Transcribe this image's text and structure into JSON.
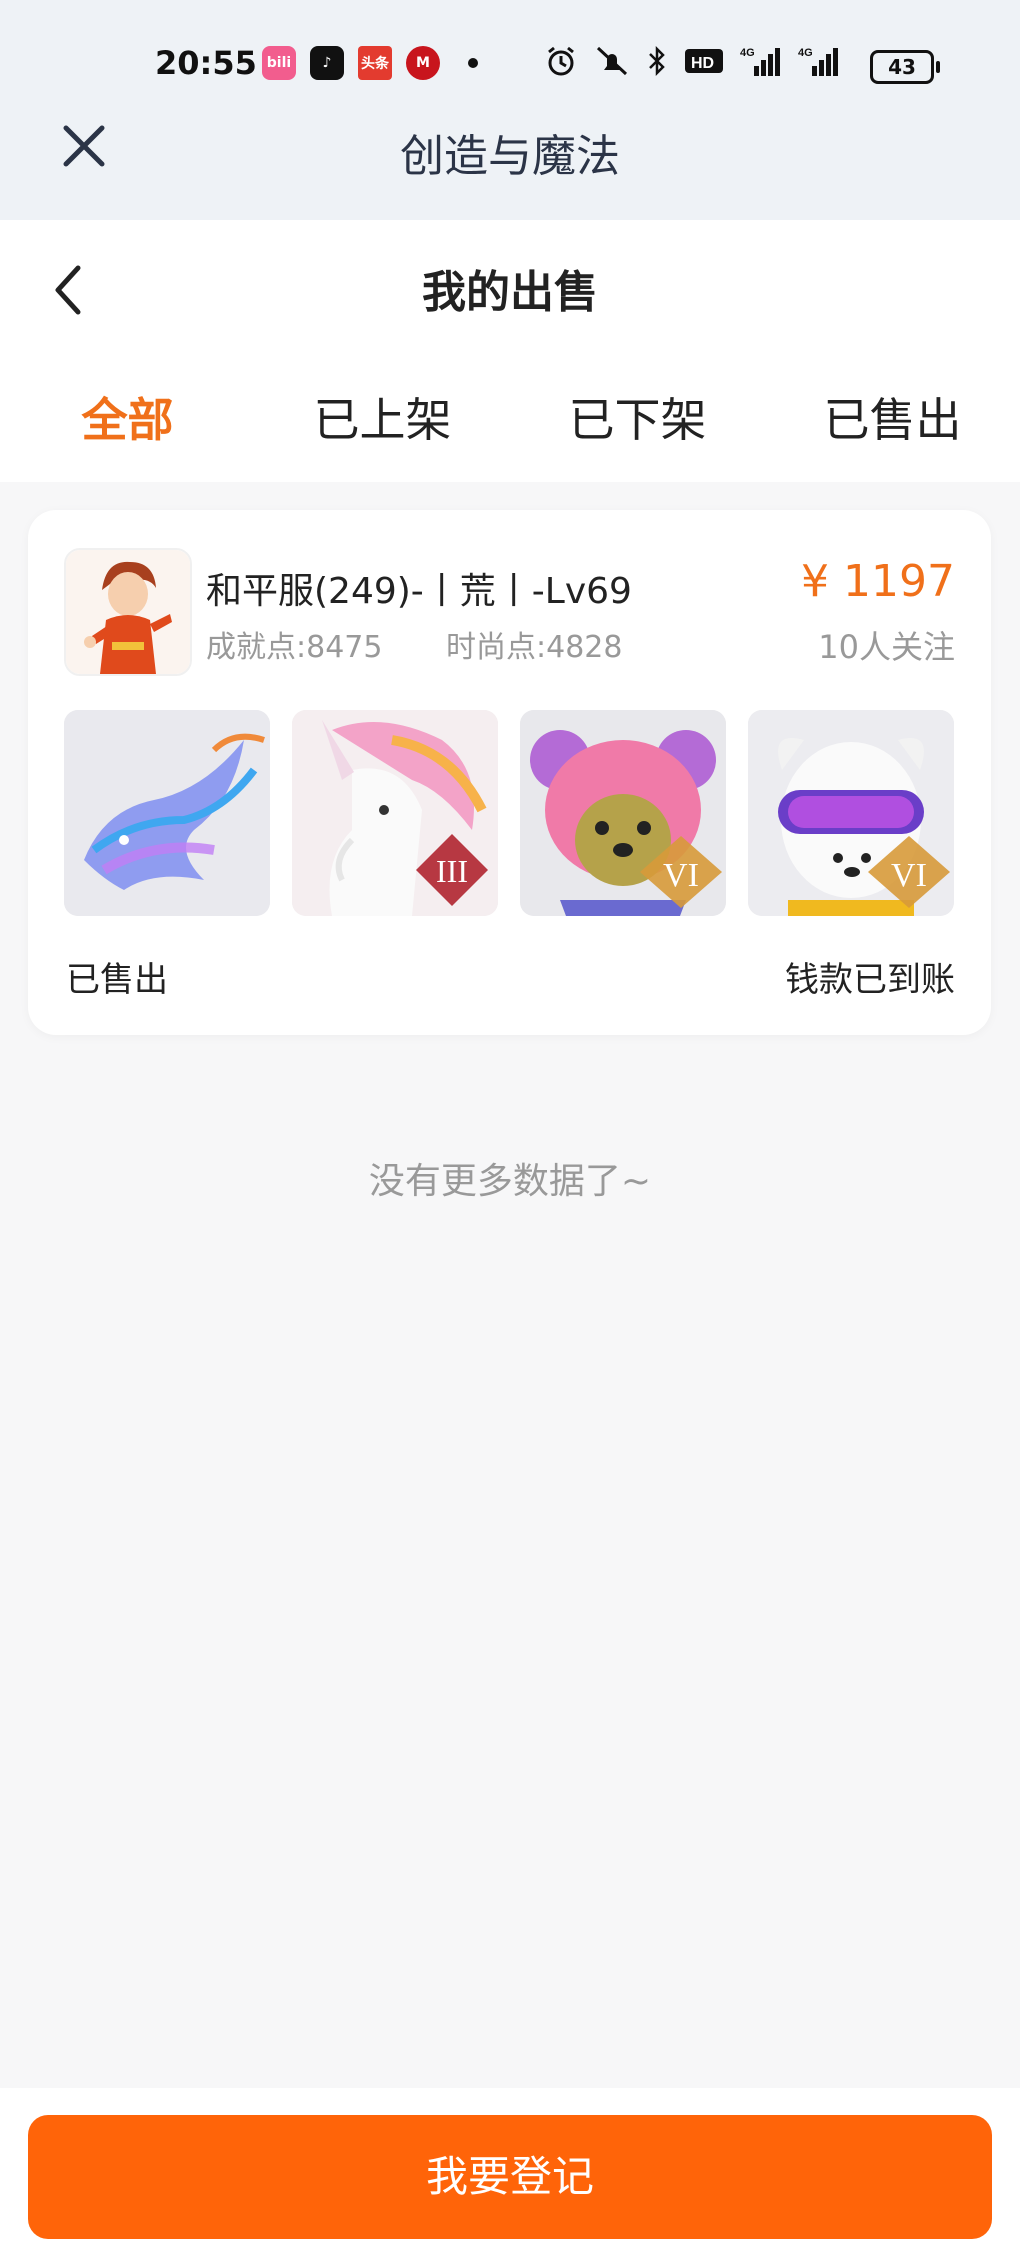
{
  "status_bar": {
    "time": "20:55",
    "app_icons": [
      "bilibili-icon",
      "douyin-icon",
      "toutiao-icon",
      "cmb-icon"
    ],
    "app_icon_labels": [
      "bili",
      "♪",
      "头条",
      "M"
    ],
    "battery": "43",
    "signal_labels": [
      "4G",
      "4G"
    ]
  },
  "titlebar": {
    "title": "创造与魔法"
  },
  "header": {
    "title": "我的出售",
    "tabs": [
      {
        "label": "全部",
        "active": true
      },
      {
        "label": "已上架",
        "active": false
      },
      {
        "label": "已下架",
        "active": false
      },
      {
        "label": "已售出",
        "active": false
      }
    ]
  },
  "listing": {
    "name": "和平服(249)-丨荒丨-Lv69",
    "achievement": "成就点:8475",
    "fashion": "时尚点:4828",
    "price": "¥ 1197",
    "followers": "10人关注",
    "thumb_badges": [
      "",
      "III",
      "VI",
      "VI"
    ],
    "status": "已售出",
    "payment_status": "钱款已到账"
  },
  "footer_text": "没有更多数据了~",
  "bottom_button": "我要登记",
  "colors": {
    "accent": "#f0701a",
    "button": "#ff6409"
  }
}
